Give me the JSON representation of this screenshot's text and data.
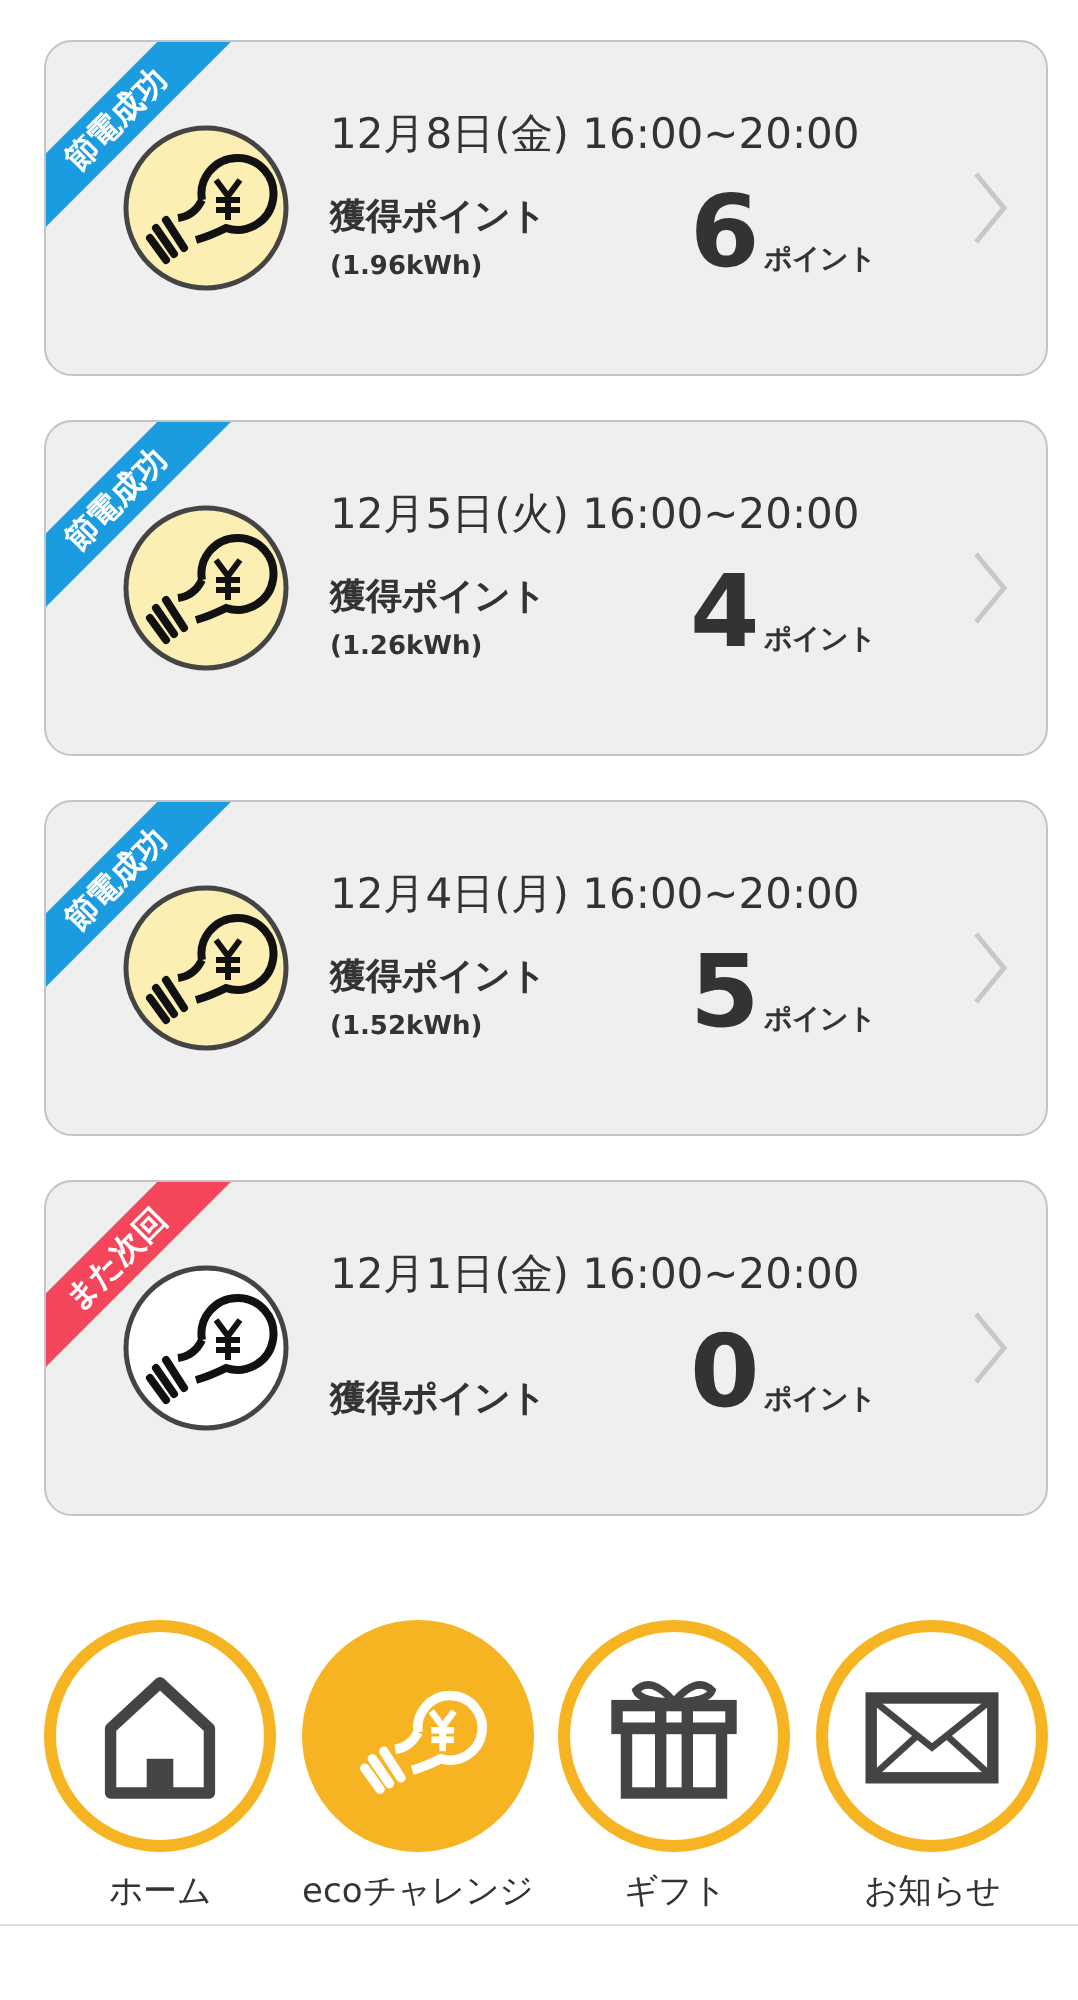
{
  "history": [
    {
      "kind": "success",
      "ribbon": "節電成功",
      "date": "12月8日(金) 16:00~20:00",
      "points_label": "獲得ポイント",
      "energy": "(1.96kWh)",
      "points": "6",
      "unit": "ポイント"
    },
    {
      "kind": "success",
      "ribbon": "節電成功",
      "date": "12月5日(火) 16:00~20:00",
      "points_label": "獲得ポイント",
      "energy": "(1.26kWh)",
      "points": "4",
      "unit": "ポイント"
    },
    {
      "kind": "success",
      "ribbon": "節電成功",
      "date": "12月4日(月) 16:00~20:00",
      "points_label": "獲得ポイント",
      "energy": "(1.52kWh)",
      "points": "5",
      "unit": "ポイント"
    },
    {
      "kind": "retry",
      "ribbon": "また次回",
      "date": "12月1日(金) 16:00~20:00",
      "points_label": "獲得ポイント",
      "points": "0",
      "unit": "ポイント"
    }
  ],
  "nav": [
    {
      "kind": "home",
      "label": "ホーム",
      "selected": false
    },
    {
      "kind": "bulb",
      "label": "ecoチャレンジ",
      "selected": true
    },
    {
      "kind": "gift",
      "label": "ギフト",
      "selected": false
    },
    {
      "kind": "mail",
      "label": "お知らせ",
      "selected": false
    }
  ]
}
